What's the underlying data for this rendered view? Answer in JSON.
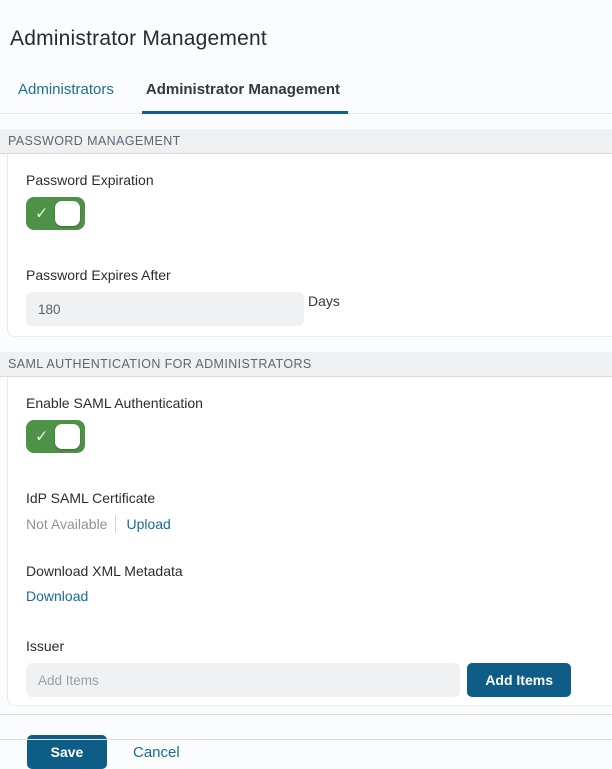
{
  "page": {
    "title": "Administrator Management"
  },
  "tabs": {
    "administrators": "Administrators",
    "administrator_management": "Administrator Management"
  },
  "icons": {
    "check": "✓"
  },
  "password_section": {
    "header": "PASSWORD MANAGEMENT",
    "expiration_label": "Password Expiration",
    "expiration_enabled": true,
    "expires_after_label": "Password Expires After",
    "expires_after_value": "180",
    "expires_after_unit": "Days"
  },
  "saml_section": {
    "header": "SAML AUTHENTICATION FOR ADMINISTRATORS",
    "enable_label": "Enable SAML Authentication",
    "enabled": true,
    "idp_cert_label": "IdP SAML Certificate",
    "idp_cert_status": "Not Available",
    "upload_label": "Upload",
    "metadata_label": "Download XML Metadata",
    "download_label": "Download",
    "issuer_label": "Issuer",
    "issuer_placeholder": "Add Items",
    "add_items_button": "Add Items"
  },
  "footer": {
    "save_label": "Save",
    "cancel_label": "Cancel"
  },
  "colors": {
    "accent_blue": "#0e5d86",
    "link_blue": "#176d99",
    "tab_underline": "#0f618e",
    "toggle_green": "#4e9247",
    "section_bar_bg": "#eef0f2",
    "input_bg": "#eff1f3"
  }
}
